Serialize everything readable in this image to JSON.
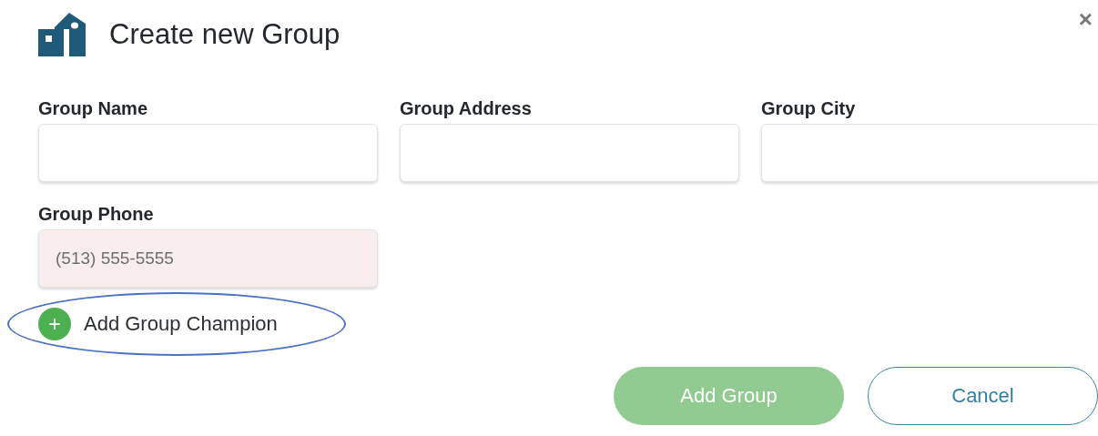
{
  "dialog": {
    "title": "Create new Group",
    "close": "×"
  },
  "fields": [
    {
      "label": "Group Name",
      "error": false
    },
    {
      "label": "Group Address",
      "error": false
    },
    {
      "label": "Group City",
      "error": false
    },
    {
      "label": "Group Phone",
      "placeholder": "(513) 555-5555",
      "error": true
    }
  ],
  "add_champion": {
    "label": "Add Group Champion",
    "icon": "+",
    "highlighted": true
  },
  "buttons": [
    {
      "kind": "primary",
      "label": "Add Group",
      "disabled": true
    },
    {
      "kind": "secondary",
      "label": "Cancel",
      "disabled": false
    }
  ]
}
